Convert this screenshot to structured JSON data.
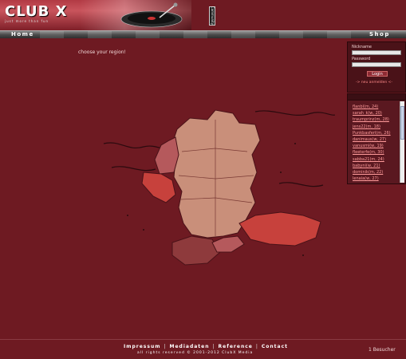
{
  "header": {
    "logo": "CLUB X",
    "logo_tagline": "just more than fun",
    "side_tab": "Community"
  },
  "nav": {
    "home": "Home",
    "shop": "Shop"
  },
  "main": {
    "prompt": "choose your region!"
  },
  "login": {
    "nickname_label": "Nickname",
    "password_label": "Password",
    "login_button": "Login",
    "register_link": "-> neu anmelden <-"
  },
  "online_users": [
    "flanbl(m, 24)",
    "sarah_k(w, 20)",
    "traumprinz(m, 28)",
    "jens22(m, 18)",
    "Punkbasferl(m, 26)",
    "danimaus(w, 27)",
    "vanusmi(w, 19)",
    "fleeterfe(m, 30)",
    "sabba21(m, 24)",
    "babyni(w, 21)",
    "dominik(m, 22)",
    "lenaia(w, 27)"
  ],
  "footer": {
    "links": [
      "Impressum",
      "Mediadaten",
      "Reference",
      "Contact"
    ],
    "copyright": "all rights reserved © 2001-2012 ClubX Media",
    "visitors": "1 Besucher"
  },
  "colors": {
    "background": "#6e1a22",
    "germany": "#c98f7a",
    "austria": "#c7413c",
    "switzerland": "#8e3a3c",
    "benelux": "#b5595c"
  }
}
